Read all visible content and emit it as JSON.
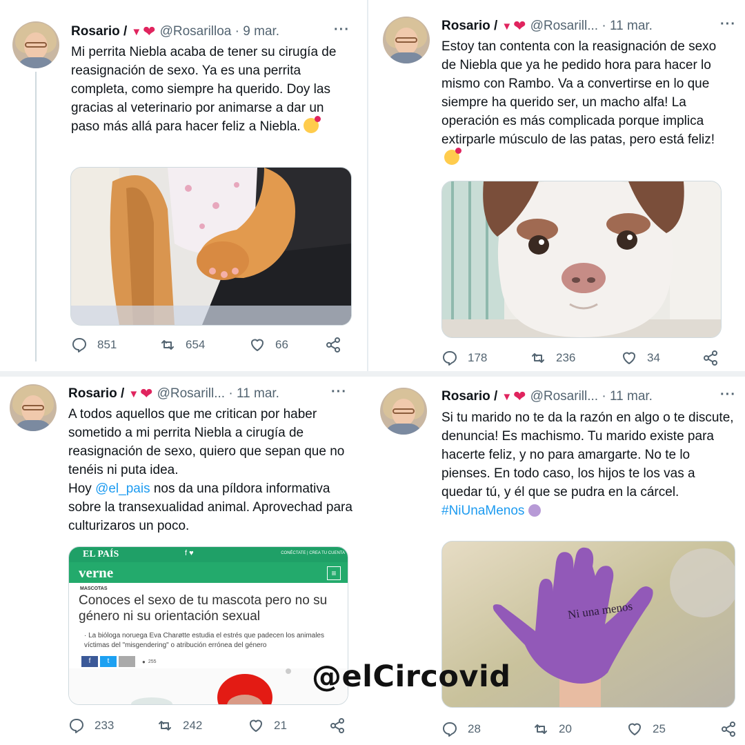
{
  "watermark": "@elCircovid",
  "tweets": [
    {
      "name": "Rosario /",
      "handle": "@Rosarilloa",
      "date": "9 mar.",
      "text": "Mi perrita Niebla acaba de tener su cirugía de reasignación de sexo. Ya es una perrita completa, como siempre ha querido. Doy las gracias al veterinario por animarse a dar un paso más allá para hacer feliz a Niebla.",
      "stats": {
        "replies": "851",
        "retweets": "654",
        "likes": "66"
      }
    },
    {
      "name": "Rosario /",
      "handle": "@Rosarill...",
      "date": "11 mar.",
      "text": "Estoy tan contenta con la reasignación de sexo de Niebla que ya he pedido hora para hacer lo mismo con Rambo. Va a convertirse en lo que siempre ha querido ser, un macho alfa! La operación es más complicada porque implica extirparle músculo de las patas, pero está feliz!",
      "stats": {
        "replies": "178",
        "retweets": "236",
        "likes": "34"
      }
    },
    {
      "name": "Rosario /",
      "handle": "@Rosarill...",
      "date": "11 mar.",
      "text_before": "A todos aquellos que me critican por haber sometido a mi perrita Niebla a cirugía de reasignación de sexo, quiero que sepan que no tenéis ni puta idea.\nHoy ",
      "mention": "@el_pais",
      "text_after": " nos da una píldora informativa sobre la transexualidad animal. Aprovechad para culturizaros un poco.",
      "stats": {
        "replies": "233",
        "retweets": "242",
        "likes": "21"
      },
      "article": {
        "masthead": "EL PAÍS",
        "top_right": "CONÉCTATE | CREA TU CUENTA",
        "section_logo": "verne",
        "kicker": "MASCOTAS",
        "headline": "Conoces el sexo de tu mascota pero no su género ni su orientación sexual",
        "summary": "· La bióloga noruega Eva Charøtte estudia el estrés que padecen los animales víctimas del \"misgendering\" o atribución errónea del género",
        "share_count": "255"
      }
    },
    {
      "name": "Rosario /",
      "handle": "@Rosarill...",
      "date": "11 mar.",
      "text": "Si tu marido no te da la razón en algo o te discute, denuncia! Es machismo. Tu marido existe para hacerte feliz, y no para amargarte. No te lo pienses. En todo caso, los hijos te los vas a quedar tú, y él que se pudra en la cárcel.",
      "hashtag": "#NiUnaMenos",
      "hand_text": "Ni una menos",
      "stats": {
        "replies": "28",
        "retweets": "20",
        "likes": "25"
      }
    }
  ]
}
